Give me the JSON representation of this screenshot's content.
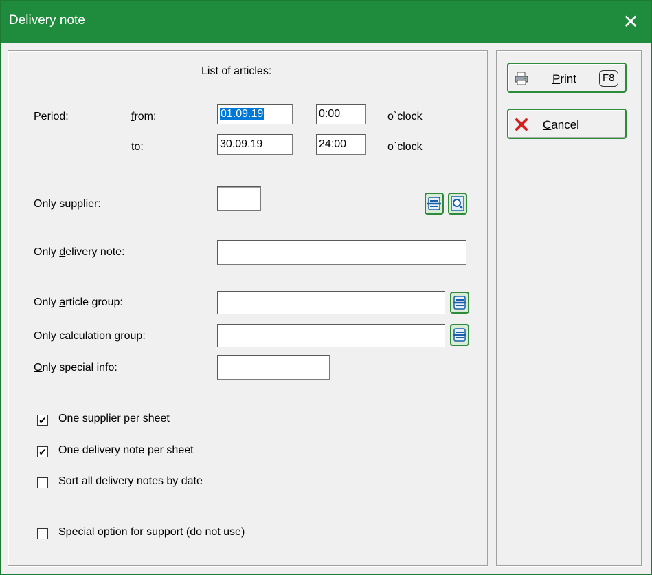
{
  "window": {
    "title": "Delivery note"
  },
  "form": {
    "heading": "List of articles:",
    "period_label": "Period:",
    "from_label": {
      "pre": "",
      "u": "f",
      "post": "rom:"
    },
    "to_label": {
      "pre": "",
      "u": "t",
      "post": "o:"
    },
    "from_date": "01.09.19",
    "from_time": "0:00",
    "to_date": "30.09.19",
    "to_time": "24:00",
    "oclock": "o`clock",
    "supplier_label": {
      "pre": "Only ",
      "u": "s",
      "post": "upplier:"
    },
    "supplier_value": "",
    "delivery_note_label": {
      "pre": "Only ",
      "u": "d",
      "post": "elivery note:"
    },
    "delivery_note_value": "",
    "article_group_label": {
      "pre": "Only ",
      "u": "a",
      "post": "rticle group:"
    },
    "article_group_value": "",
    "calc_group_label": {
      "pre": "",
      "u": "O",
      "post": "nly calculation group:"
    },
    "calc_group_value": "",
    "special_info_label": {
      "pre": "",
      "u": "O",
      "post": "nly special info:"
    },
    "special_info_value": ""
  },
  "options": [
    {
      "label": "One supplier per sheet",
      "checked": true
    },
    {
      "label": "One delivery note per sheet",
      "checked": true
    },
    {
      "label": "Sort all delivery notes by date",
      "checked": false
    },
    {
      "label": "Special option for support (do not use)",
      "checked": false
    }
  ],
  "buttons": {
    "print": {
      "u": "P",
      "post": "rint",
      "key": "F8"
    },
    "cancel": {
      "u": "C",
      "post": "ancel"
    }
  },
  "icons": {
    "print": "printer-icon",
    "cancel": "red-x-icon",
    "list": "list-icon",
    "search": "magnifier-icon"
  }
}
